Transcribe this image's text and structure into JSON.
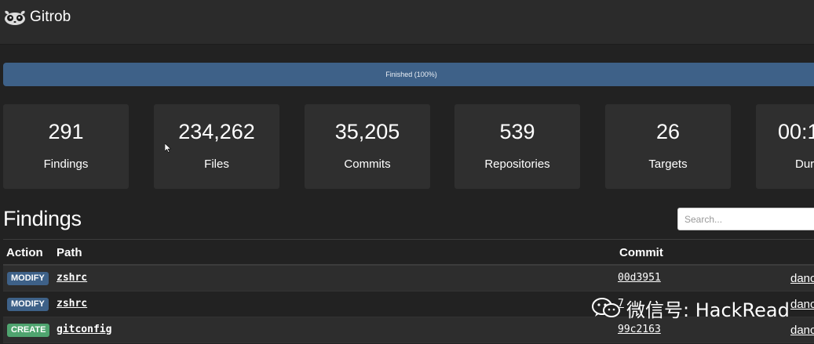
{
  "app": {
    "name": "Gitrob"
  },
  "progress": {
    "label": "Finished (100%)",
    "percent": 100
  },
  "stats": [
    {
      "value": "291",
      "label": "Findings"
    },
    {
      "value": "234,262",
      "label": "Files"
    },
    {
      "value": "35,205",
      "label": "Commits"
    },
    {
      "value": "539",
      "label": "Repositories"
    },
    {
      "value": "26",
      "label": "Targets"
    },
    {
      "value": "00:1",
      "label": "Dur"
    }
  ],
  "findings": {
    "title": "Findings",
    "search_placeholder": "Search...",
    "columns": {
      "action": "Action",
      "path": "Path",
      "commit": "Commit"
    },
    "rows": [
      {
        "action": "MODIFY",
        "path": "zshrc",
        "commit": "00d3951",
        "author": "danc"
      },
      {
        "action": "MODIFY",
        "path": "zshrc",
        "commit": "7",
        "author": "danc"
      },
      {
        "action": "CREATE",
        "path": "gitconfig",
        "commit": "99c2163",
        "author": "danc"
      }
    ]
  },
  "watermark": {
    "text": "微信号: HackRead"
  },
  "colors": {
    "background": "#222222",
    "navbar": "#2b2b2b",
    "card": "#2f2f2f",
    "progress": "#3e6188",
    "modify_badge": "#3e6188",
    "create_badge": "#4fa46f"
  },
  "icons": {
    "brand": "gitrob-logo-icon",
    "cursor": "mouse-cursor-icon",
    "watermark": "wechat-icon"
  }
}
